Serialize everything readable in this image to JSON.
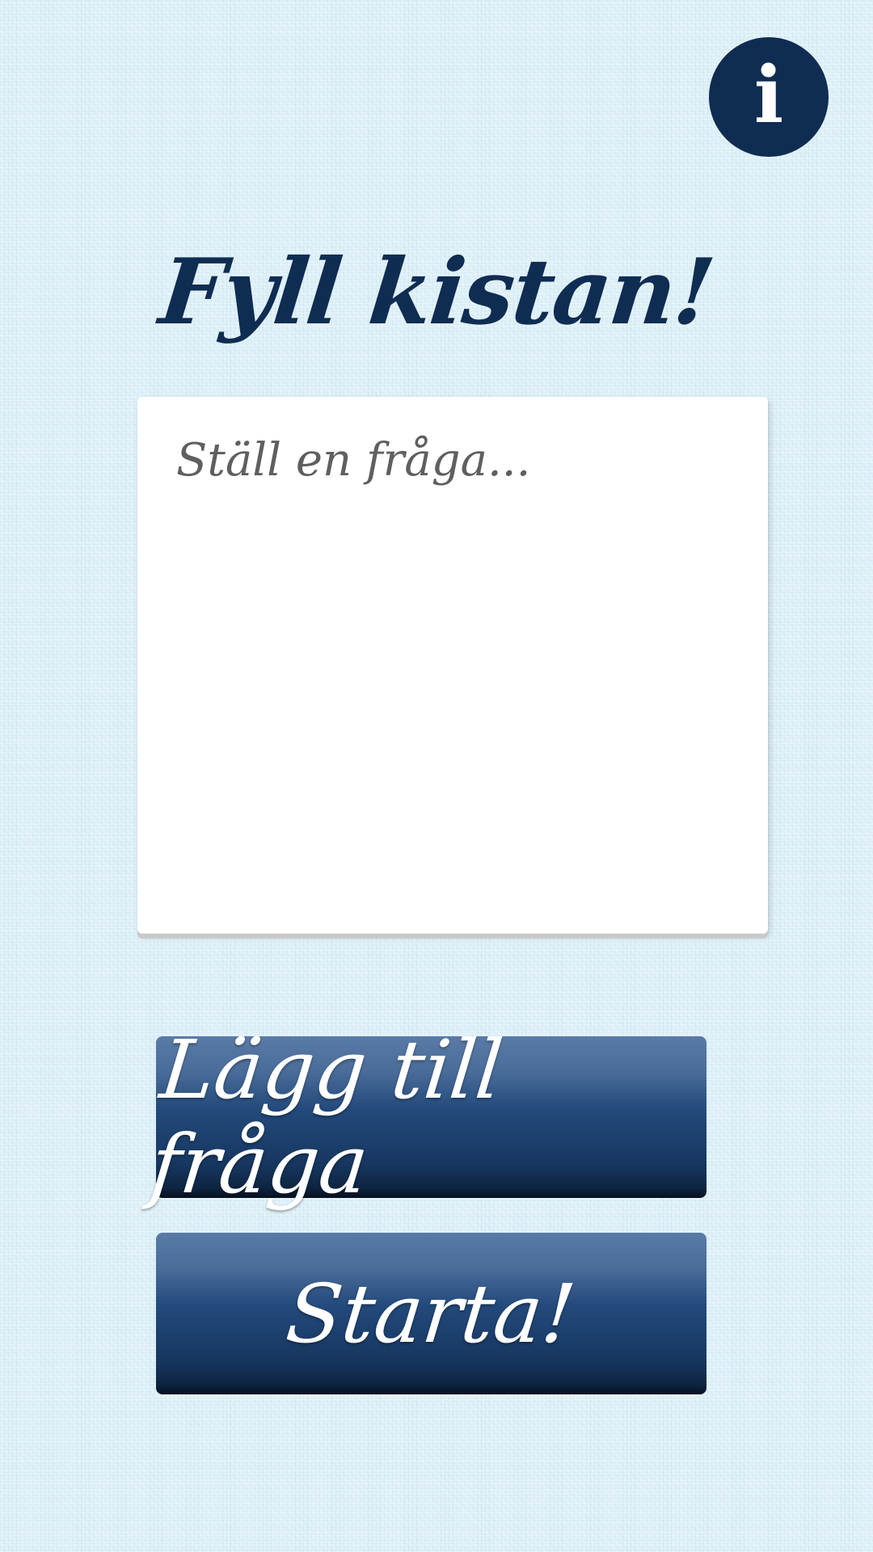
{
  "info_button": {
    "icon": "info-icon",
    "glyph": "i",
    "color": "#0f2c52"
  },
  "title": "Fyll kistan!",
  "question_input": {
    "placeholder": "Ställ en fråga...",
    "value": ""
  },
  "buttons": {
    "add_question_label": "Lägg till fråga",
    "start_label": "Starta!"
  },
  "colors": {
    "background": "#dceff7",
    "accent": "#0f2c52",
    "button_top": "#5a7ba6",
    "button_bottom": "#0d2440"
  }
}
